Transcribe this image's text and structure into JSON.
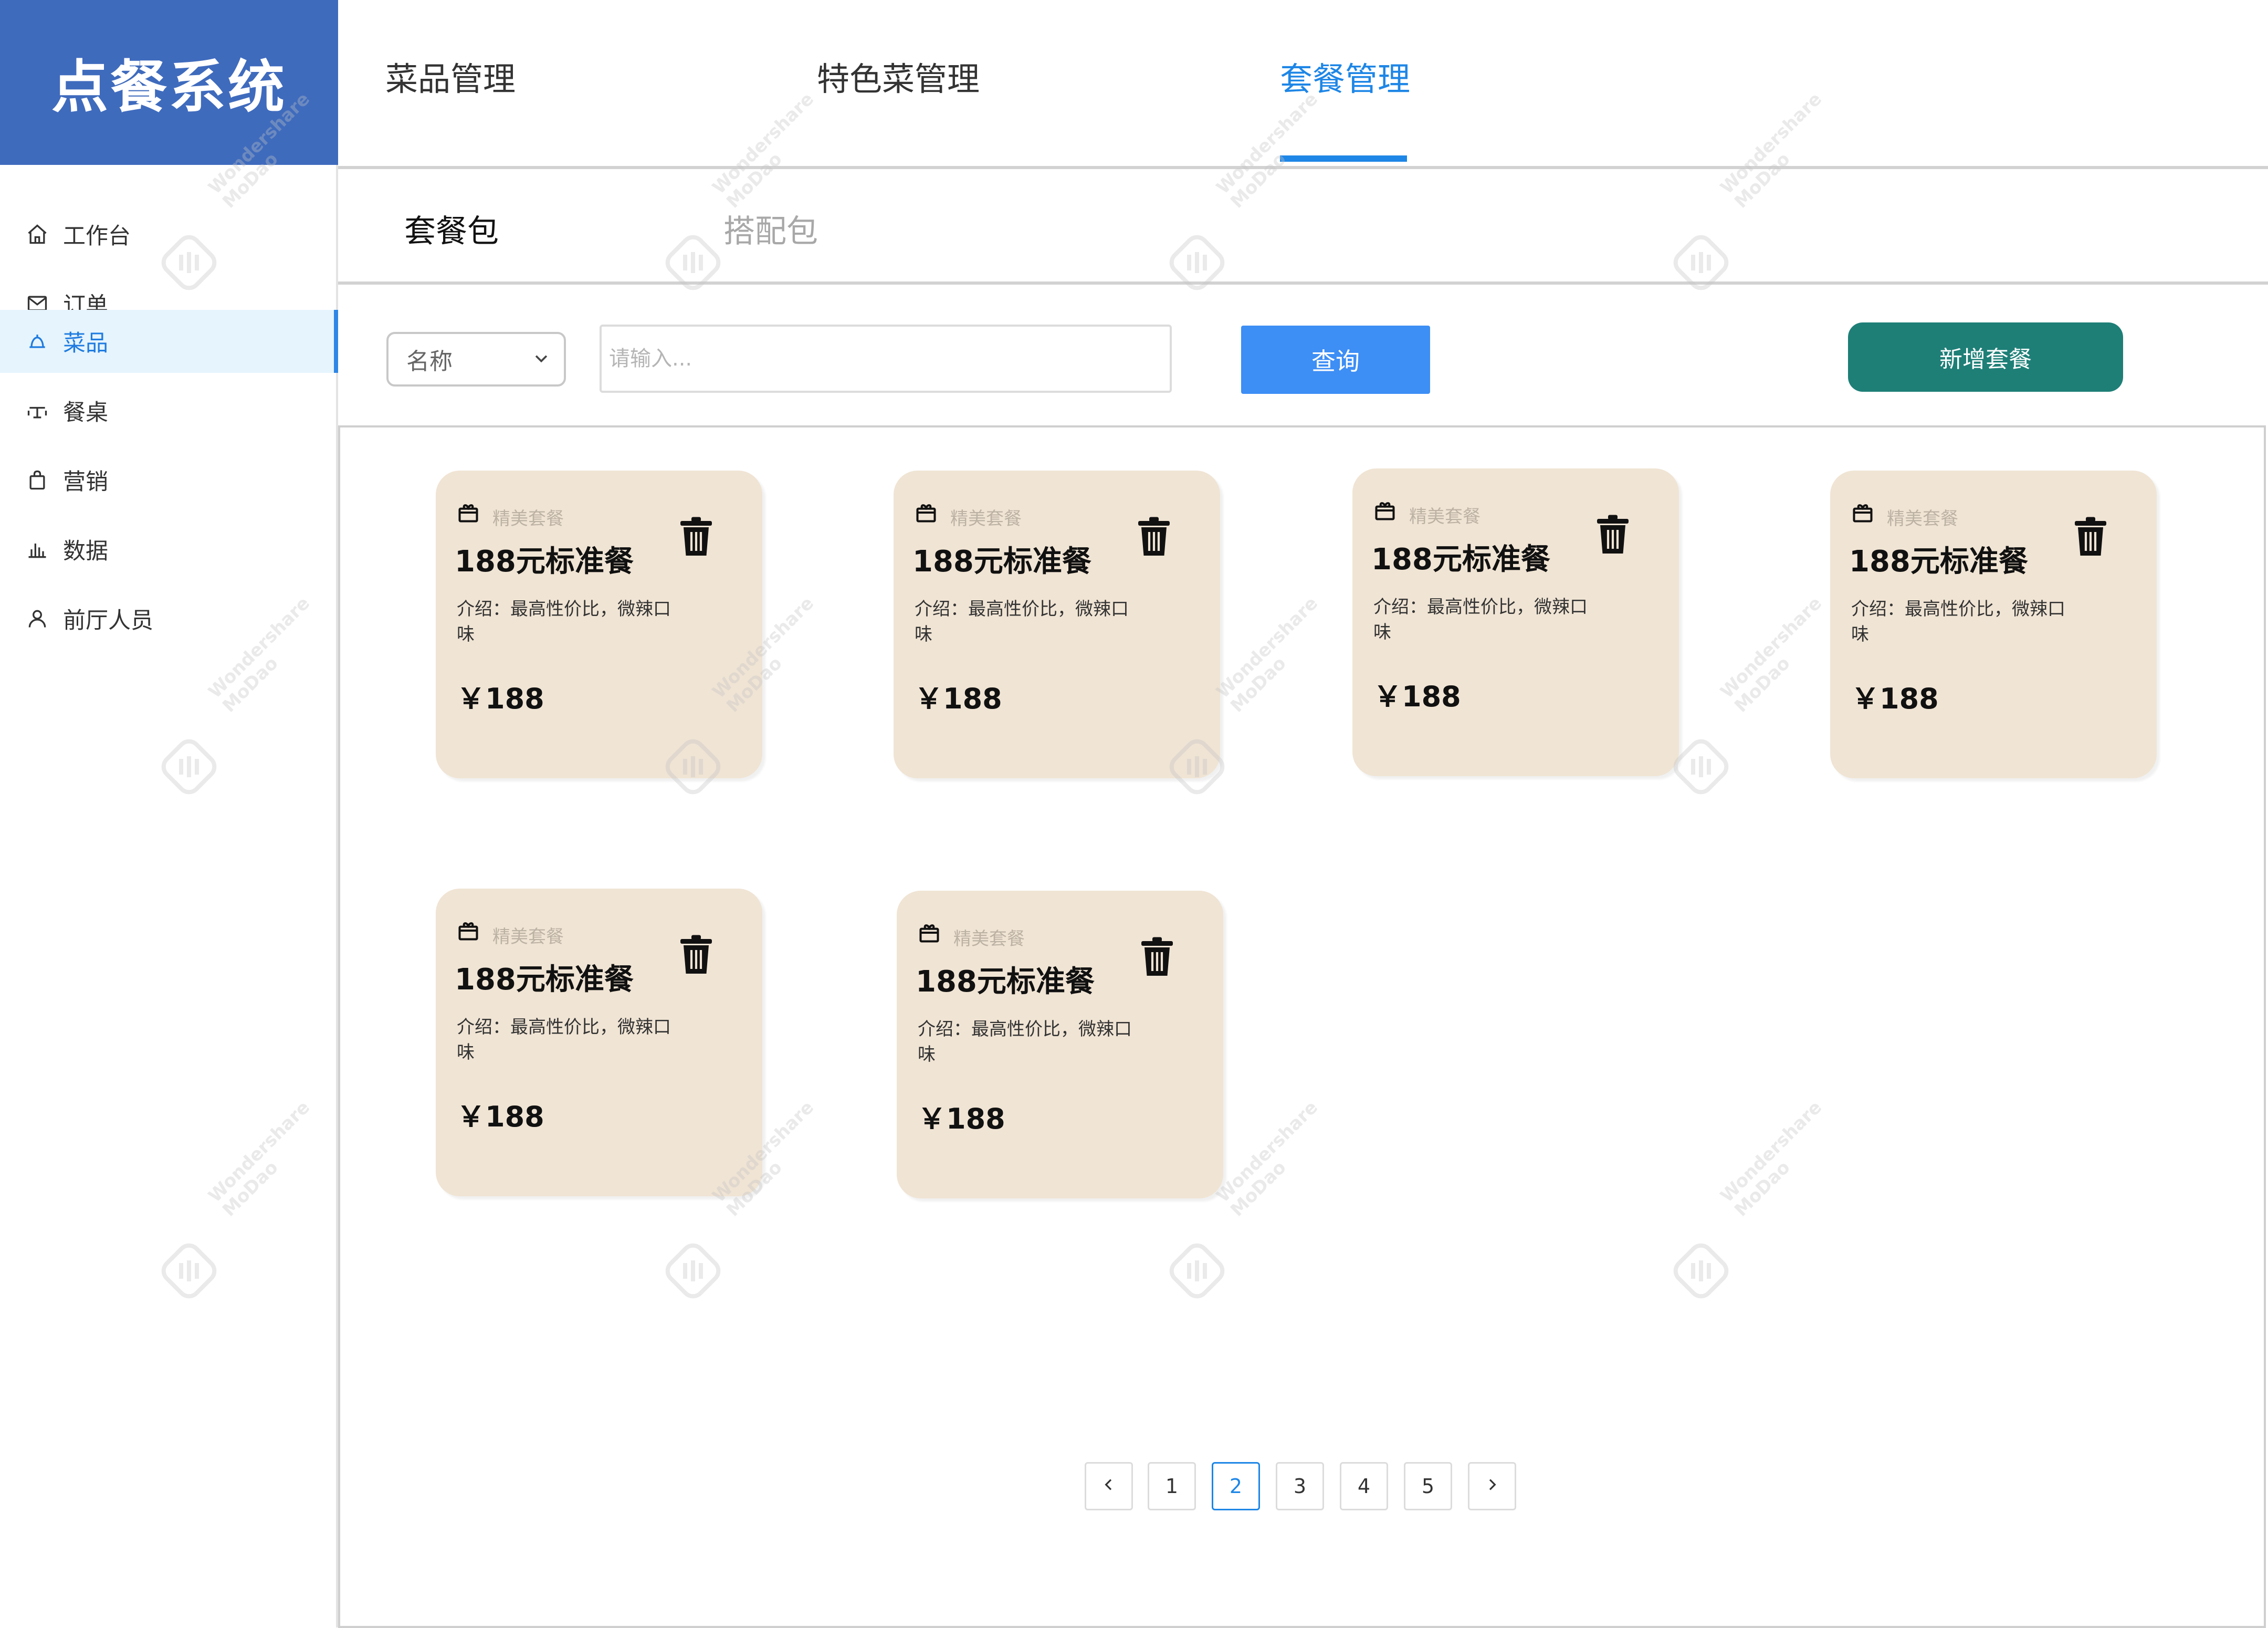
{
  "app": {
    "title": "点餐系统"
  },
  "sidebar": {
    "items": [
      {
        "label": "工作台",
        "icon": "home-icon",
        "active": false
      },
      {
        "label": "订单",
        "icon": "mail-icon",
        "active": false
      },
      {
        "label": "菜品",
        "icon": "dish-bell-icon",
        "active": true
      },
      {
        "label": "餐桌",
        "icon": "table-icon",
        "active": false
      },
      {
        "label": "营销",
        "icon": "shopping-bag-icon",
        "active": false
      },
      {
        "label": "数据",
        "icon": "bar-chart-icon",
        "active": false
      },
      {
        "label": "前厅人员",
        "icon": "user-icon",
        "active": false
      }
    ]
  },
  "top_tabs": [
    {
      "label": "菜品管理",
      "active": false
    },
    {
      "label": "特色菜管理",
      "active": false
    },
    {
      "label": "套餐管理",
      "active": true
    }
  ],
  "sub_tabs": [
    {
      "label": "套餐包",
      "active": true
    },
    {
      "label": "搭配包",
      "active": false
    }
  ],
  "search": {
    "field_value": "名称",
    "placeholder": "请输入...",
    "query_label": "查询",
    "add_label": "新增套餐"
  },
  "cards": [
    {
      "tag": "精美套餐",
      "name": "188元标准餐",
      "desc": "介绍：最高性价比，微辣口味",
      "price": "￥188"
    },
    {
      "tag": "精美套餐",
      "name": "188元标准餐",
      "desc": "介绍：最高性价比，微辣口味",
      "price": "￥188"
    },
    {
      "tag": "精美套餐",
      "name": "188元标准餐",
      "desc": "介绍：最高性价比，微辣口味",
      "price": "￥188"
    },
    {
      "tag": "精美套餐",
      "name": "188元标准餐",
      "desc": "介绍：最高性价比，微辣口味",
      "price": "￥188"
    },
    {
      "tag": "精美套餐",
      "name": "188元标准餐",
      "desc": "介绍：最高性价比，微辣口味",
      "price": "￥188"
    },
    {
      "tag": "精美套餐",
      "name": "188元标准餐",
      "desc": "介绍：最高性价比，微辣口味",
      "price": "￥188"
    }
  ],
  "pagination": {
    "pages": [
      "1",
      "2",
      "3",
      "4",
      "5"
    ],
    "current": "2",
    "prev_icon": "chevron-left-icon",
    "next_icon": "chevron-right-icon"
  },
  "watermark": {
    "brand": "Wondershare",
    "product": "MoDao"
  },
  "colors": {
    "logo_bg": "#3f6bbd",
    "accent": "#1e86e6",
    "query_button": "#3d8ef5",
    "add_button": "#1e7f77",
    "card_bg": "#f0e4d4",
    "active_nav_bg": "#e6f4fd"
  }
}
